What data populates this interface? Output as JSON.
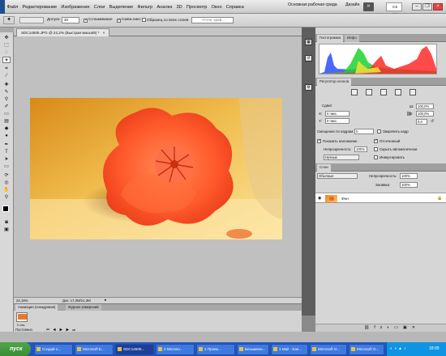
{
  "menubar": {
    "items": [
      "Файл",
      "Редактирование",
      "Изображение",
      "Слои",
      "Выделение",
      "Фильтр",
      "Анализ",
      "3D",
      "Просмотр",
      "Окно",
      "Справка"
    ],
    "workspace_label": "Основная рабочая среда",
    "design_label": "Дизайн",
    "cslive_label": "CS Live"
  },
  "options": {
    "feather_label": "Допуск:",
    "feather_value": "30",
    "antialias_label": "Сглаживание",
    "contiguous_label": "Смеж.пикс",
    "all_layers_label": "Образец со всех слоев",
    "refine_label": "Уточн. край..."
  },
  "document": {
    "tab_title": "SDC14505.JPG @ 22,2% (Быстрая маска/8) *",
    "zoom": "22,18%",
    "doc_size": "Док: 17,3М/21,3М"
  },
  "histogram": {
    "tabs": [
      "Гистограмма",
      "Инфо"
    ]
  },
  "adjust": {
    "title": "Регулятор клонов",
    "source_label": "Сдвиг:",
    "x_label": "X:",
    "x_value": "0 пикс.",
    "y_label": "Y:",
    "y_value": "0 пикс.",
    "w_label": "Ш:",
    "w_value": "100,0%",
    "h_label": "В:",
    "h_value": "100,0%",
    "angle_value": "0,0",
    "frame_offset_label": "Смещение по кадрам:",
    "frame_offset_value": "0",
    "lock_frame_label": "Закрепить кадр",
    "show_overlay_label": "Показать наложение",
    "clipped_label": "Отсеченный",
    "opacity_label": "Непрозрачность:",
    "opacity_value": "100%",
    "auto_hide_label": "Скрыть автоматически",
    "mode_value": "Нучные",
    "invert_label": "Инвертировать"
  },
  "layers": {
    "tabs": [
      "Слои"
    ],
    "blend_mode": "Обычные",
    "opacity_label": "Непрозрачность:",
    "opacity_value": "100%",
    "fill_label": "Заливка:",
    "fill_value": "100%",
    "layer_name": "Фон"
  },
  "bottom": {
    "tabs": [
      "Анимация (покадровая)",
      "Журнал измерений"
    ],
    "frame_time": "0 сек.",
    "loop_label": "Постоянно"
  },
  "taskbar": {
    "start_label": "пуск",
    "buttons": [
      "Создай о...",
      "Microsoft E...",
      "SDC14505...",
      "2 Microso...",
      "2 Прово...",
      "Безымянн...",
      "1 Mail - Kas...",
      "Microsoft O...",
      "Microsoft O..."
    ],
    "clock": "18:09"
  },
  "colors": {
    "accent_blue": "#2657c7",
    "panel_gray": "#d6d6d6",
    "histogram_bg": "#ffffff"
  }
}
